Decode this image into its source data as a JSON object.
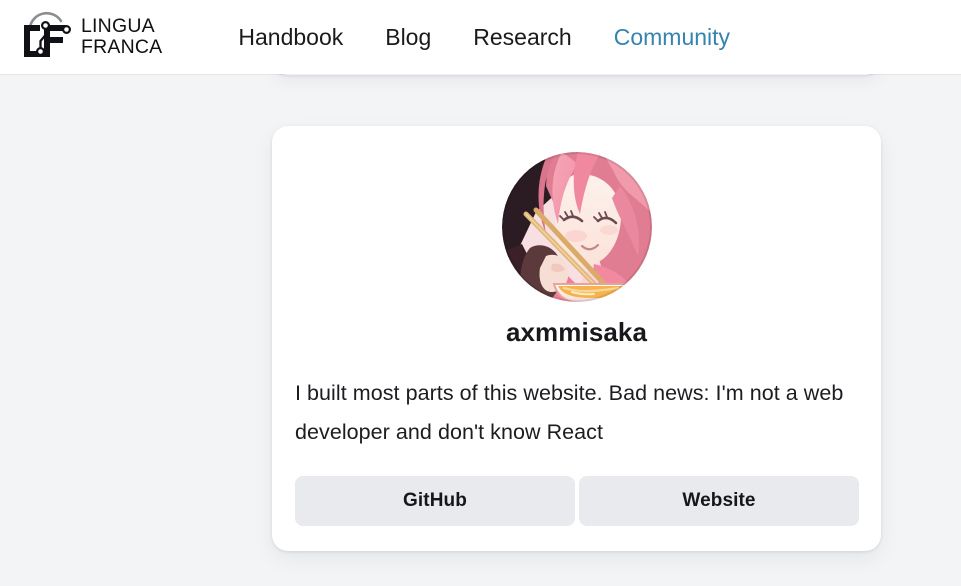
{
  "header": {
    "brand": {
      "logo_icon": "lingua-franca-lf-monogram-icon",
      "line1": "LINGUA",
      "line2": "FRANCA"
    },
    "nav": [
      {
        "label": "Handbook",
        "active": false
      },
      {
        "label": "Blog",
        "active": false
      },
      {
        "label": "Research",
        "active": false
      },
      {
        "label": "Community",
        "active": true
      }
    ],
    "active_color": "#3583ae"
  },
  "profile": {
    "avatar_alt": "anime-avatar-pink-haired-character-eating-ramen",
    "name": "axmmisaka",
    "bio": "I built most parts of this website. Bad news: I'm not a web developer and don't know React",
    "links": [
      {
        "label": "GitHub"
      },
      {
        "label": "Website"
      }
    ]
  },
  "theme": {
    "page_background": "#f3f4f6",
    "card_background": "#ffffff",
    "button_background": "#e9eaee",
    "text_color": "#1c1d20"
  }
}
